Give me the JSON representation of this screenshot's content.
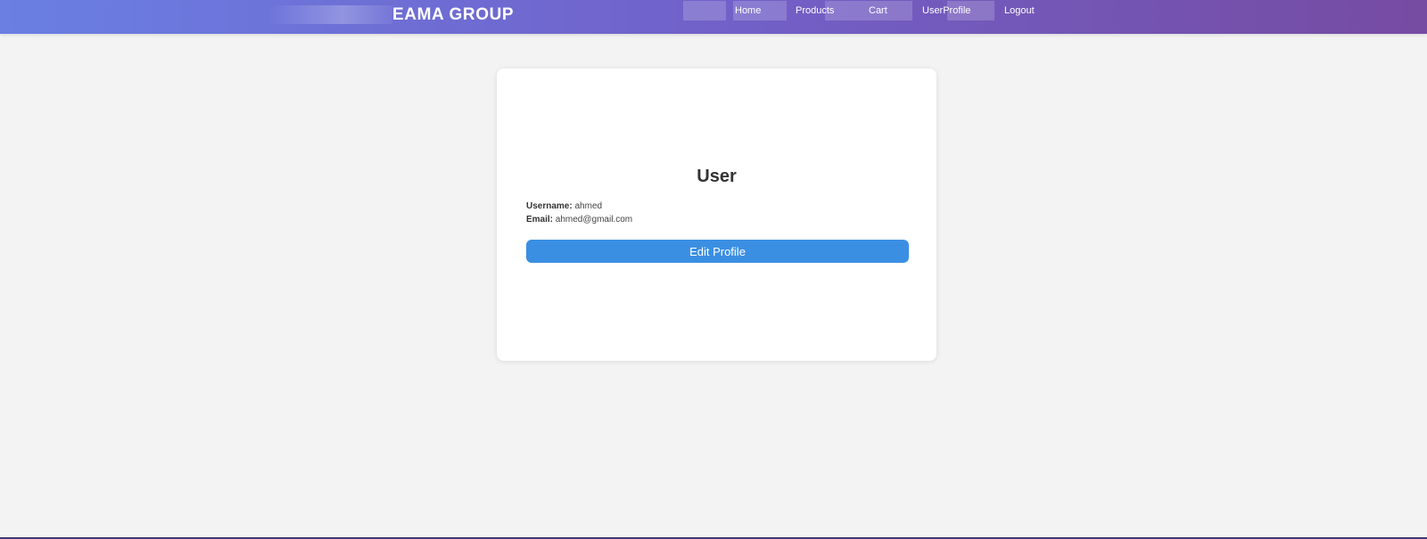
{
  "navbar": {
    "brand": "EAMA GROUP",
    "links": [
      {
        "label": "Home"
      },
      {
        "label": "Products"
      },
      {
        "label": "Cart"
      },
      {
        "label": "UserProfile"
      },
      {
        "label": "Logout"
      }
    ]
  },
  "profile": {
    "title": "User",
    "username_label": "Username:",
    "username_value": "ahmed",
    "email_label": "Email:",
    "email_value": "ahmed@gmail.com",
    "edit_button": "Edit Profile"
  },
  "colors": {
    "navbar_gradient_start": "#6a7fe3",
    "navbar_gradient_end": "#764ba2",
    "button": "#3b8fe3",
    "background": "#f3f3f3"
  }
}
